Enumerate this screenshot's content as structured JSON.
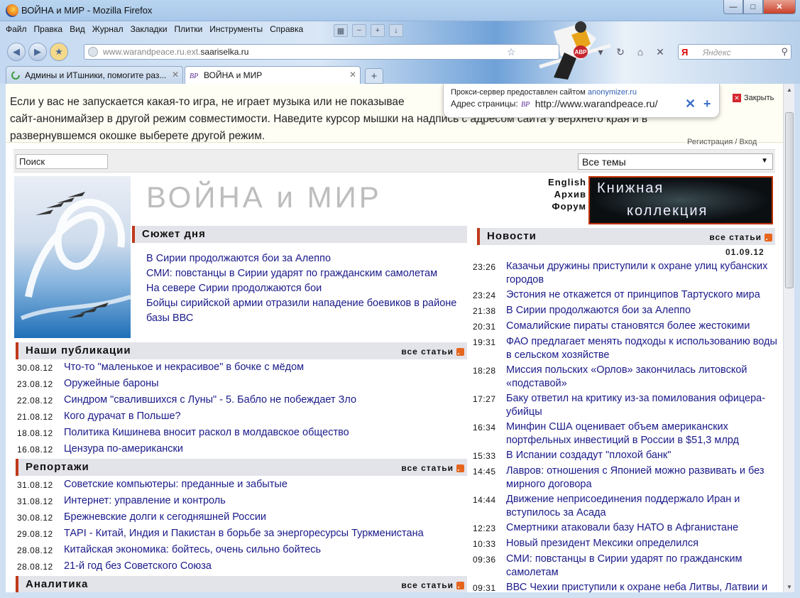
{
  "window": {
    "title": "ВОЙНА и МИР - Mozilla Firefox"
  },
  "menu": [
    "Файл",
    "Правка",
    "Вид",
    "Журнал",
    "Закладки",
    "Плитки",
    "Инструменты",
    "Справка"
  ],
  "urlbar": {
    "prefix": "www.warandpeace.ru.ext.",
    "host": "saariselka.ru"
  },
  "search": {
    "placeholder": "Яндекс",
    "engine": "Я"
  },
  "tabs": [
    {
      "label": "Админы и ИТшники, помогите раз..."
    },
    {
      "label": "ВОЙНА и МИР"
    }
  ],
  "notice": {
    "text": "Если у вас не запускается какая-то игра, не играет музыка или не показывае... сайт-анонимайзер в другой режим совместимости. Наведите курсор мышки на надпись с адресом сайта у верхнего края и в развернувшемся окошке выберете другой режим.",
    "line1": "Если у вас не запускается какая-то игра, не играет музыка или не показывае",
    "line2": "сайт-анонимайзер в другой режим совместимости. Наведите курсор мышки на надпись с адресом сайта у верхнего края и в",
    "line3": "развернувшемся окошке выберете другой режим.",
    "close": "Закрыть"
  },
  "proxy": {
    "line1": "Прокси-сервер предоставлен сайтом",
    "provider": "anonymizer.ru",
    "label": "Адрес страницы:",
    "url": "http://www.warandpeace.ru/"
  },
  "auth": {
    "text": "Регистрация / Вход"
  },
  "site": {
    "search_value": "Поиск",
    "topic_select": "Все темы",
    "title": "ВОЙНА и МИР",
    "links": [
      "English",
      "Архив",
      "Форум"
    ],
    "banner": {
      "line1": "Книжная",
      "line2": "коллекция"
    }
  },
  "plot_of_day": {
    "heading": "Сюжет дня",
    "items": [
      "В Сирии продолжаются бои за Алеппо",
      "СМИ: повстанцы в Сирии ударят по гражданским самолетам",
      "На севере Сирии продолжаются бои",
      "Бойцы сирийской армии отразили нападение боевиков в районе базы ВВС"
    ]
  },
  "publications": {
    "heading": "Наши публикации",
    "all": "все статьи",
    "items": [
      {
        "date": "30.08.12",
        "title": "Что-то \"маленькое и некрасивое\" в бочке с мёдом"
      },
      {
        "date": "23.08.12",
        "title": "Оружейные бароны"
      },
      {
        "date": "22.08.12",
        "title": "Синдром \"свалившихся с Луны\" - 5. Бабло не побеждает Зло"
      },
      {
        "date": "21.08.12",
        "title": "Кого дурачат в Польше?"
      },
      {
        "date": "18.08.12",
        "title": "Политика Кишинева вносит раскол в молдавское общество"
      },
      {
        "date": "16.08.12",
        "title": "Цензура по-американски"
      }
    ]
  },
  "reports": {
    "heading": "Репортажи",
    "all": "все статьи",
    "items": [
      {
        "date": "31.08.12",
        "title": "Советские компьютеры: преданные и забытые"
      },
      {
        "date": "31.08.12",
        "title": "Интернет: управление и контроль"
      },
      {
        "date": "30.08.12",
        "title": "Брежневские долги к сегодняшней России"
      },
      {
        "date": "29.08.12",
        "title": "ТАРI - Китай, Индия и Пакистан в борьбе за энергоресурсы Туркменистана"
      },
      {
        "date": "28.08.12",
        "title": "Китайская экономика: бойтесь, очень сильно бойтесь"
      },
      {
        "date": "28.08.12",
        "title": "21-й год без Советского Союза"
      }
    ]
  },
  "analytics": {
    "heading": "Аналитика",
    "all": "все статьи"
  },
  "news": {
    "heading": "Новости",
    "all": "все статьи",
    "date": "01.09.12",
    "items": [
      {
        "time": "23:26",
        "title": "Казачьи дружины приступили к охране улиц кубанских городов"
      },
      {
        "time": "23:24",
        "title": "Эстония не откажется от принципов Тартуского мира"
      },
      {
        "time": "21:38",
        "title": "В Сирии продолжаются бои за Алеппо"
      },
      {
        "time": "20:31",
        "title": "Сомалийские пираты становятся более жестокими"
      },
      {
        "time": "19:31",
        "title": "ФАО предлагает менять подходы к использованию воды в сельском хозяйстве"
      },
      {
        "time": "18:28",
        "title": "Миссия польских «Орлов» закончилась литовской «подставой»"
      },
      {
        "time": "17:27",
        "title": "Баку ответил на критику из-за помилования офицера-убийцы"
      },
      {
        "time": "16:34",
        "title": "Минфин США оценивает объем американских портфельных инвестиций в России в $51,3 млрд"
      },
      {
        "time": "15:33",
        "title": "В Испании создадут \"плохой банк\""
      },
      {
        "time": "14:45",
        "title": "Лавров: отношения с Японией можно развивать и без мирного договора"
      },
      {
        "time": "14:44",
        "title": "Движение неприсоединения поддержало Иран и вступилось за Асада"
      },
      {
        "time": "12:23",
        "title": "Смертники атаковали базу НАТО в Афганистане"
      },
      {
        "time": "10:33",
        "title": "Новый президент Мексики определился"
      },
      {
        "time": "09:36",
        "title": "СМИ: повстанцы в Сирии ударят по гражданским самолетам"
      },
      {
        "time": "09:31",
        "title": "ВВС Чехии приступили к охране неба Литвы, Латвии и"
      }
    ]
  },
  "colors": {
    "accent": "#c0391b",
    "link": "#1a1a8a",
    "rss": "#e6651c"
  }
}
